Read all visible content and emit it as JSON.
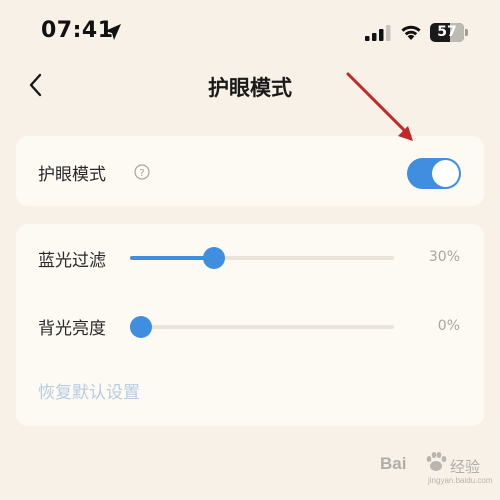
{
  "status_bar": {
    "time": "07:41",
    "battery_level": "57",
    "icons": [
      "location-arrow-icon",
      "cellular-signal-icon",
      "wifi-icon",
      "battery-icon"
    ]
  },
  "nav": {
    "back_icon": "chevron-left-icon",
    "title": "护眼模式"
  },
  "eye_protection": {
    "label": "护眼模式",
    "help_icon": "question-circle-icon",
    "enabled": true
  },
  "sliders": [
    {
      "label": "蓝光过滤",
      "value_text": "30%",
      "value": 0.3
    },
    {
      "label": "背光亮度",
      "value_text": "0%",
      "value": 0.0
    }
  ],
  "reset_label": "恢复默认设置",
  "colors": {
    "background": "#f7f1e7",
    "card": "#fdf9f3",
    "accent": "#3f8ee0",
    "annotation": "#c0282a",
    "reset_link": "#b6cde2"
  },
  "watermark": {
    "brand": "Bai",
    "sub": "经验",
    "url": "jingyan.baidu.com"
  }
}
